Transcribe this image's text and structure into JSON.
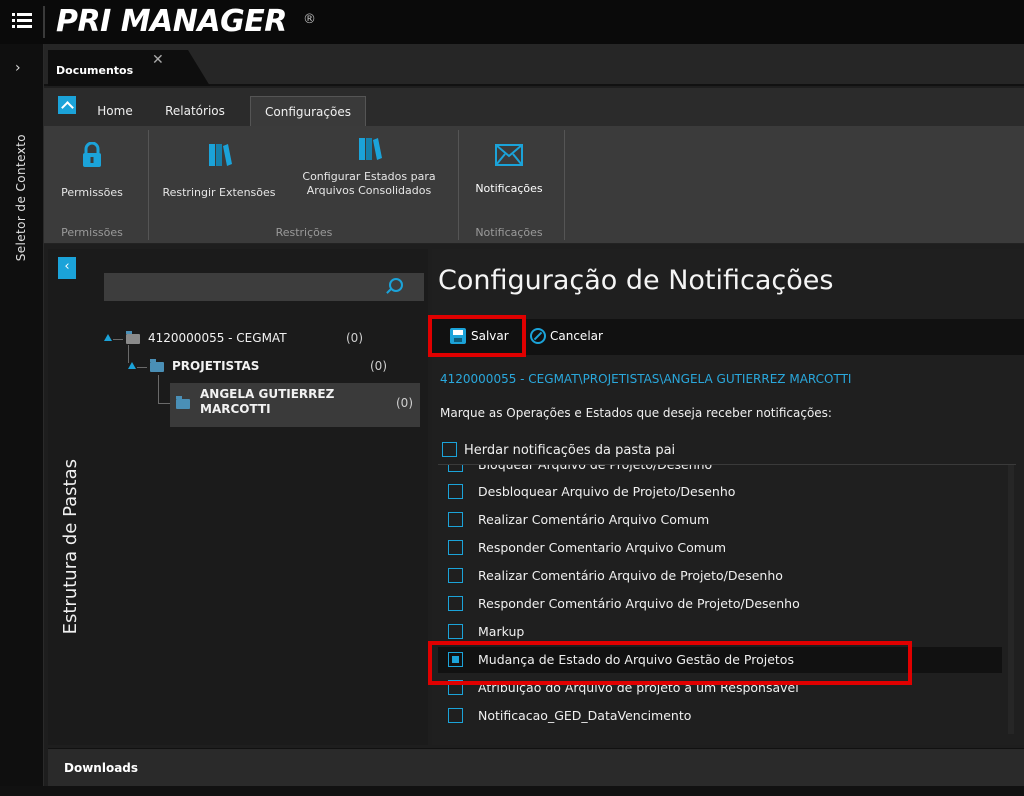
{
  "app": {
    "title": "PRI MANAGER",
    "registered_mark": "®"
  },
  "context_strip": {
    "label": "Seletor de Contexto"
  },
  "document_tab": {
    "label": "Documentos",
    "close": "✕"
  },
  "ribbon": {
    "tabs": [
      "Home",
      "Relatórios",
      "Configurações"
    ],
    "active_tab": "Configurações",
    "buttons": {
      "permissoes": "Permissões",
      "restringir": "Restringir Extensões",
      "configurar_estados_line1": "Configurar Estados para",
      "configurar_estados_line2": "Arquivos Consolidados",
      "notificacoes": "Notificações"
    },
    "groups": {
      "permissoes": "Permissões",
      "restricoes": "Restrições",
      "notificacoes": "Notificações"
    }
  },
  "folder_panel": {
    "title": "Estrutura de Pastas",
    "search_placeholder": "",
    "tree": [
      {
        "label": "4120000055 - CEGMAT",
        "count": "(0)"
      },
      {
        "label": "PROJETISTAS",
        "count": "(0)"
      },
      {
        "label_line1": "ANGELA GUTIERREZ",
        "label_line2": "MARCOTTI",
        "count": "(0)"
      }
    ]
  },
  "main": {
    "title": "Configuração de Notificações",
    "toolbar": {
      "save_label": "Salvar",
      "cancel_label": "Cancelar"
    },
    "path": "4120000055 - CEGMAT\\PROJETISTAS\\ANGELA GUTIERREZ MARCOTTI",
    "instructions": "Marque as Operações e Estados que deseja receber notificações:",
    "inherit_label": "Herdar notificações da pasta pai",
    "inherit_checked": false,
    "operations": [
      {
        "label": "Bloquear Arquivo de Projeto/Desenho",
        "checked": false
      },
      {
        "label": "Desbloquear Arquivo de Projeto/Desenho",
        "checked": false
      },
      {
        "label": "Realizar Comentário Arquivo Comum",
        "checked": false
      },
      {
        "label": "Responder Comentario Arquivo Comum",
        "checked": false
      },
      {
        "label": "Realizar Comentário Arquivo de Projeto/Desenho",
        "checked": false
      },
      {
        "label": "Responder Comentário Arquivo de Projeto/Desenho",
        "checked": false
      },
      {
        "label": "Markup",
        "checked": false
      },
      {
        "label": "Mudança de Estado do Arquivo Gestão de Projetos",
        "checked": true
      },
      {
        "label": "Atribuição do Arquivo de projeto a um Responsável",
        "checked": false
      },
      {
        "label": "Notificacao_GED_DataVencimento",
        "checked": false
      }
    ]
  },
  "downloads": {
    "label": "Downloads"
  },
  "colors": {
    "accent": "#1ba3d9",
    "highlight": "#e00000",
    "background": "#1e1e1e"
  }
}
